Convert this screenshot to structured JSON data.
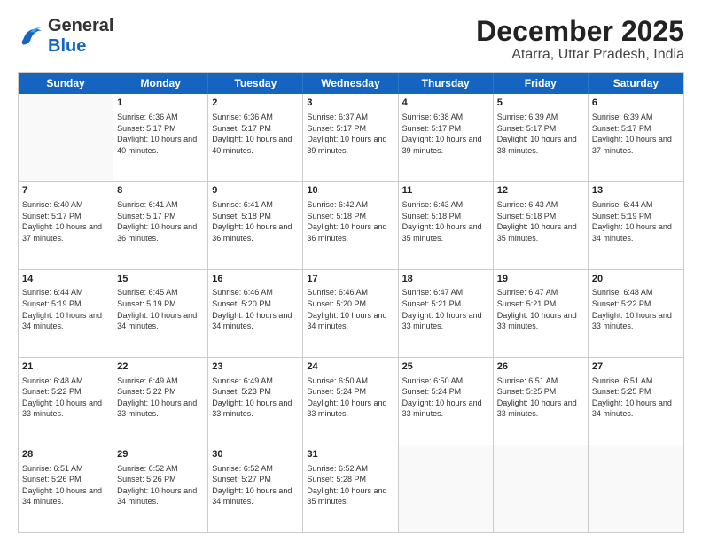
{
  "header": {
    "logo_general": "General",
    "logo_blue": "Blue",
    "title": "December 2025",
    "subtitle": "Atarra, Uttar Pradesh, India"
  },
  "days_of_week": [
    "Sunday",
    "Monday",
    "Tuesday",
    "Wednesday",
    "Thursday",
    "Friday",
    "Saturday"
  ],
  "weeks": [
    [
      {
        "day": "",
        "sunrise": "",
        "sunset": "",
        "daylight": "",
        "empty": true
      },
      {
        "day": "1",
        "sunrise": "Sunrise: 6:36 AM",
        "sunset": "Sunset: 5:17 PM",
        "daylight": "Daylight: 10 hours and 40 minutes.",
        "empty": false
      },
      {
        "day": "2",
        "sunrise": "Sunrise: 6:36 AM",
        "sunset": "Sunset: 5:17 PM",
        "daylight": "Daylight: 10 hours and 40 minutes.",
        "empty": false
      },
      {
        "day": "3",
        "sunrise": "Sunrise: 6:37 AM",
        "sunset": "Sunset: 5:17 PM",
        "daylight": "Daylight: 10 hours and 39 minutes.",
        "empty": false
      },
      {
        "day": "4",
        "sunrise": "Sunrise: 6:38 AM",
        "sunset": "Sunset: 5:17 PM",
        "daylight": "Daylight: 10 hours and 39 minutes.",
        "empty": false
      },
      {
        "day": "5",
        "sunrise": "Sunrise: 6:39 AM",
        "sunset": "Sunset: 5:17 PM",
        "daylight": "Daylight: 10 hours and 38 minutes.",
        "empty": false
      },
      {
        "day": "6",
        "sunrise": "Sunrise: 6:39 AM",
        "sunset": "Sunset: 5:17 PM",
        "daylight": "Daylight: 10 hours and 37 minutes.",
        "empty": false
      }
    ],
    [
      {
        "day": "7",
        "sunrise": "Sunrise: 6:40 AM",
        "sunset": "Sunset: 5:17 PM",
        "daylight": "Daylight: 10 hours and 37 minutes.",
        "empty": false
      },
      {
        "day": "8",
        "sunrise": "Sunrise: 6:41 AM",
        "sunset": "Sunset: 5:17 PM",
        "daylight": "Daylight: 10 hours and 36 minutes.",
        "empty": false
      },
      {
        "day": "9",
        "sunrise": "Sunrise: 6:41 AM",
        "sunset": "Sunset: 5:18 PM",
        "daylight": "Daylight: 10 hours and 36 minutes.",
        "empty": false
      },
      {
        "day": "10",
        "sunrise": "Sunrise: 6:42 AM",
        "sunset": "Sunset: 5:18 PM",
        "daylight": "Daylight: 10 hours and 36 minutes.",
        "empty": false
      },
      {
        "day": "11",
        "sunrise": "Sunrise: 6:43 AM",
        "sunset": "Sunset: 5:18 PM",
        "daylight": "Daylight: 10 hours and 35 minutes.",
        "empty": false
      },
      {
        "day": "12",
        "sunrise": "Sunrise: 6:43 AM",
        "sunset": "Sunset: 5:18 PM",
        "daylight": "Daylight: 10 hours and 35 minutes.",
        "empty": false
      },
      {
        "day": "13",
        "sunrise": "Sunrise: 6:44 AM",
        "sunset": "Sunset: 5:19 PM",
        "daylight": "Daylight: 10 hours and 34 minutes.",
        "empty": false
      }
    ],
    [
      {
        "day": "14",
        "sunrise": "Sunrise: 6:44 AM",
        "sunset": "Sunset: 5:19 PM",
        "daylight": "Daylight: 10 hours and 34 minutes.",
        "empty": false
      },
      {
        "day": "15",
        "sunrise": "Sunrise: 6:45 AM",
        "sunset": "Sunset: 5:19 PM",
        "daylight": "Daylight: 10 hours and 34 minutes.",
        "empty": false
      },
      {
        "day": "16",
        "sunrise": "Sunrise: 6:46 AM",
        "sunset": "Sunset: 5:20 PM",
        "daylight": "Daylight: 10 hours and 34 minutes.",
        "empty": false
      },
      {
        "day": "17",
        "sunrise": "Sunrise: 6:46 AM",
        "sunset": "Sunset: 5:20 PM",
        "daylight": "Daylight: 10 hours and 34 minutes.",
        "empty": false
      },
      {
        "day": "18",
        "sunrise": "Sunrise: 6:47 AM",
        "sunset": "Sunset: 5:21 PM",
        "daylight": "Daylight: 10 hours and 33 minutes.",
        "empty": false
      },
      {
        "day": "19",
        "sunrise": "Sunrise: 6:47 AM",
        "sunset": "Sunset: 5:21 PM",
        "daylight": "Daylight: 10 hours and 33 minutes.",
        "empty": false
      },
      {
        "day": "20",
        "sunrise": "Sunrise: 6:48 AM",
        "sunset": "Sunset: 5:22 PM",
        "daylight": "Daylight: 10 hours and 33 minutes.",
        "empty": false
      }
    ],
    [
      {
        "day": "21",
        "sunrise": "Sunrise: 6:48 AM",
        "sunset": "Sunset: 5:22 PM",
        "daylight": "Daylight: 10 hours and 33 minutes.",
        "empty": false
      },
      {
        "day": "22",
        "sunrise": "Sunrise: 6:49 AM",
        "sunset": "Sunset: 5:22 PM",
        "daylight": "Daylight: 10 hours and 33 minutes.",
        "empty": false
      },
      {
        "day": "23",
        "sunrise": "Sunrise: 6:49 AM",
        "sunset": "Sunset: 5:23 PM",
        "daylight": "Daylight: 10 hours and 33 minutes.",
        "empty": false
      },
      {
        "day": "24",
        "sunrise": "Sunrise: 6:50 AM",
        "sunset": "Sunset: 5:24 PM",
        "daylight": "Daylight: 10 hours and 33 minutes.",
        "empty": false
      },
      {
        "day": "25",
        "sunrise": "Sunrise: 6:50 AM",
        "sunset": "Sunset: 5:24 PM",
        "daylight": "Daylight: 10 hours and 33 minutes.",
        "empty": false
      },
      {
        "day": "26",
        "sunrise": "Sunrise: 6:51 AM",
        "sunset": "Sunset: 5:25 PM",
        "daylight": "Daylight: 10 hours and 33 minutes.",
        "empty": false
      },
      {
        "day": "27",
        "sunrise": "Sunrise: 6:51 AM",
        "sunset": "Sunset: 5:25 PM",
        "daylight": "Daylight: 10 hours and 34 minutes.",
        "empty": false
      }
    ],
    [
      {
        "day": "28",
        "sunrise": "Sunrise: 6:51 AM",
        "sunset": "Sunset: 5:26 PM",
        "daylight": "Daylight: 10 hours and 34 minutes.",
        "empty": false
      },
      {
        "day": "29",
        "sunrise": "Sunrise: 6:52 AM",
        "sunset": "Sunset: 5:26 PM",
        "daylight": "Daylight: 10 hours and 34 minutes.",
        "empty": false
      },
      {
        "day": "30",
        "sunrise": "Sunrise: 6:52 AM",
        "sunset": "Sunset: 5:27 PM",
        "daylight": "Daylight: 10 hours and 34 minutes.",
        "empty": false
      },
      {
        "day": "31",
        "sunrise": "Sunrise: 6:52 AM",
        "sunset": "Sunset: 5:28 PM",
        "daylight": "Daylight: 10 hours and 35 minutes.",
        "empty": false
      },
      {
        "day": "",
        "sunrise": "",
        "sunset": "",
        "daylight": "",
        "empty": true
      },
      {
        "day": "",
        "sunrise": "",
        "sunset": "",
        "daylight": "",
        "empty": true
      },
      {
        "day": "",
        "sunrise": "",
        "sunset": "",
        "daylight": "",
        "empty": true
      }
    ]
  ]
}
